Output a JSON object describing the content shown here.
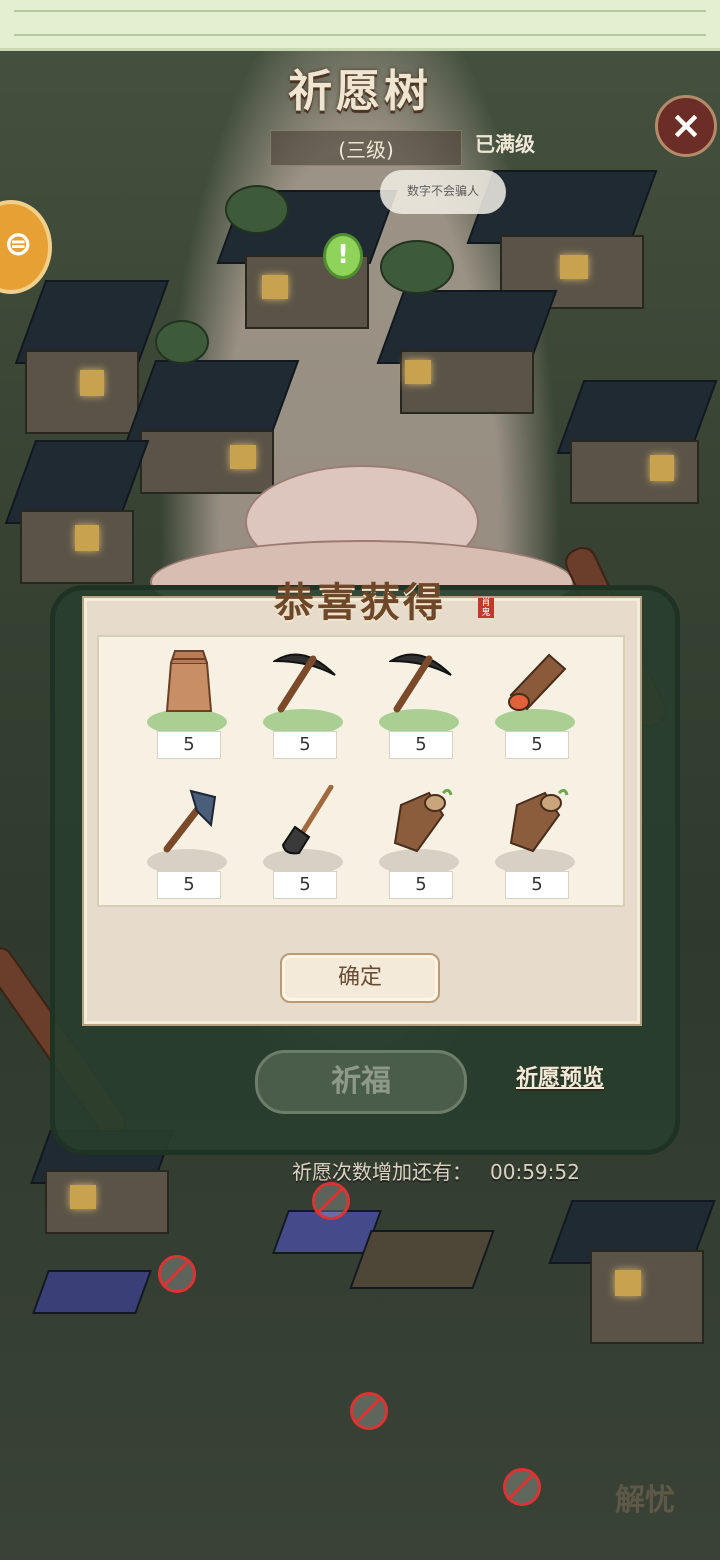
{
  "header": {
    "title": "祈愿树",
    "level": "(三级)",
    "max_label": "已满级"
  },
  "npc_bubble": "数字不会骗人",
  "reward_popup": {
    "title": "恭喜获得",
    "items": [
      {
        "icon": "seed-bag-icon",
        "count": "5"
      },
      {
        "icon": "pickaxe-icon",
        "count": "5"
      },
      {
        "icon": "pickaxe-icon",
        "count": "5"
      },
      {
        "icon": "log-icon",
        "count": "5"
      },
      {
        "icon": "axe-icon",
        "count": "5"
      },
      {
        "icon": "shovel-icon",
        "count": "5"
      },
      {
        "icon": "tree-stump-icon",
        "count": "5"
      },
      {
        "icon": "tree-stump-icon",
        "count": "5"
      }
    ],
    "confirm_label": "确定"
  },
  "actions": {
    "pray_label": "祈福",
    "preview_label": "祈愿预览"
  },
  "timer": {
    "label": "祈愿次数增加还有：",
    "value": "00:59:52"
  },
  "colors": {
    "panel_green": "#283e2d",
    "cream": "#f6f1e3",
    "brown_text": "#6e4728"
  }
}
